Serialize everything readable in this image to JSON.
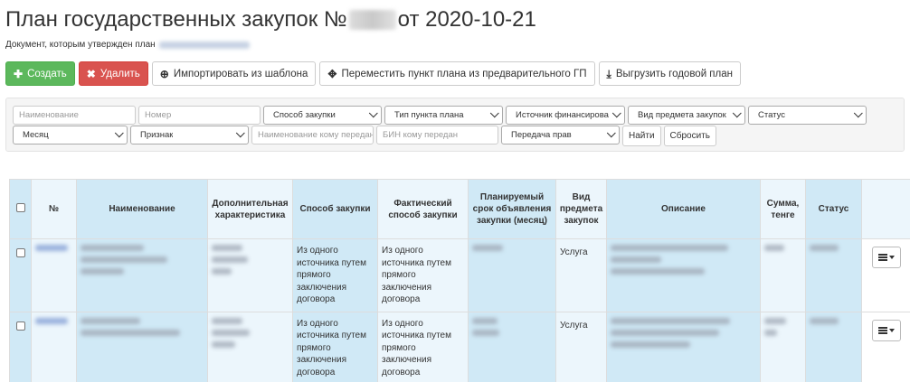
{
  "page": {
    "title_prefix": "План государственных закупок №",
    "title_suffix": " от 2020-10-21",
    "subtitle": "Документ, которым утвержден план"
  },
  "toolbar": {
    "create": "Создать",
    "delete": "Удалить",
    "import": "Импортировать из шаблона",
    "move": "Переместить пункт плана из предварительного ГП",
    "export": "Выгрузить годовой план"
  },
  "filters": {
    "name_placeholder": "Наименование",
    "number_placeholder": "Номер",
    "procurement_method": "Способ закупки",
    "item_type": "Тип пункта плана",
    "funding_source": "Источник финансирования",
    "subject_type": "Вид предмета закупок",
    "status": "Статус",
    "month": "Месяц",
    "attribute": "Признак",
    "transferee_name_placeholder": "Наименование кому передан",
    "transferee_bin_placeholder": "БИН кому передан",
    "rights_transfer": "Передача прав",
    "find": "Найти",
    "reset": "Сбросить"
  },
  "table": {
    "headers": {
      "num": "№",
      "name": "Наименование",
      "extra": "Дополнительная характеристика",
      "method": "Способ закупки",
      "actual_method": "Фактический способ закупки",
      "planned": "Планируемый срок объявления закупки (месяц)",
      "subject_type": "Вид предмета закупок",
      "description": "Описание",
      "sum": "Сумма, тенге",
      "status": "Статус"
    },
    "rows": [
      {
        "method": "Из одного источника путем прямого заключения договора",
        "actual_method": "Из одного источника путем прямого заключения договора",
        "subject_type": "Услуга"
      },
      {
        "method": "Из одного источника путем прямого заключения договора",
        "actual_method": "Из одного источника путем прямого заключения договора",
        "subject_type": "Услуга"
      }
    ]
  },
  "colors": {
    "success": "#5cb85c",
    "danger": "#d9534f",
    "highlight_column": "#d0e9f6",
    "light_column": "#ecf6fc"
  },
  "icons": {
    "create": "plus-icon",
    "delete": "x-icon",
    "import": "upload-circle-icon",
    "move": "move-arrows-icon",
    "export": "download-icon",
    "row_menu": "hamburger-menu-icon"
  }
}
